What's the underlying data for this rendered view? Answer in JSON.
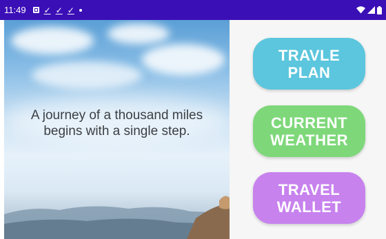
{
  "status_bar": {
    "time": "11:49",
    "background": "#3b0fb6",
    "notification_icons": [
      "image-icon",
      "download-done-icon",
      "download-done-icon",
      "download-done-icon",
      "dot-icon"
    ],
    "system_icons": [
      "wifi-icon",
      "signal-icon",
      "battery-icon"
    ]
  },
  "hero": {
    "quote_line1": "A journey of a thousand miles",
    "quote_line2": "begins with a single step."
  },
  "menu": {
    "buttons": [
      {
        "label": "TRAVLE\nPLAN",
        "color": "#5bc6dd"
      },
      {
        "label": "CURRENT\nWEATHER",
        "color": "#7ed87a"
      },
      {
        "label": "TRAVEL\nWALLET",
        "color": "#c782ee"
      }
    ]
  }
}
